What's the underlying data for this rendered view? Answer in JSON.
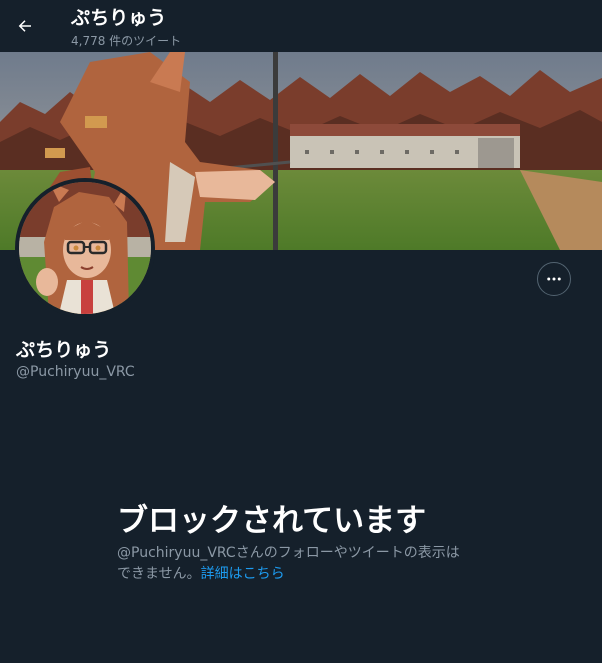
{
  "header": {
    "back_icon": "arrow-left-icon",
    "name": "ぷちりゅう",
    "tweet_count": "4,778 件のツイート"
  },
  "profile": {
    "name": "ぷちりゅう",
    "handle": "@Puchiryuu_VRC",
    "more_icon": "more-horizontal-icon"
  },
  "blocked": {
    "title": "ブロックされています",
    "description_line1": "@Puchiryuu_VRCさんのフォローやツイートの表示は",
    "description_line2": "できません。",
    "link_text": "詳細はこちら"
  },
  "colors": {
    "background": "#15202b",
    "text_primary": "#ffffff",
    "text_secondary": "#8b98a5",
    "link": "#1d9bf0"
  }
}
